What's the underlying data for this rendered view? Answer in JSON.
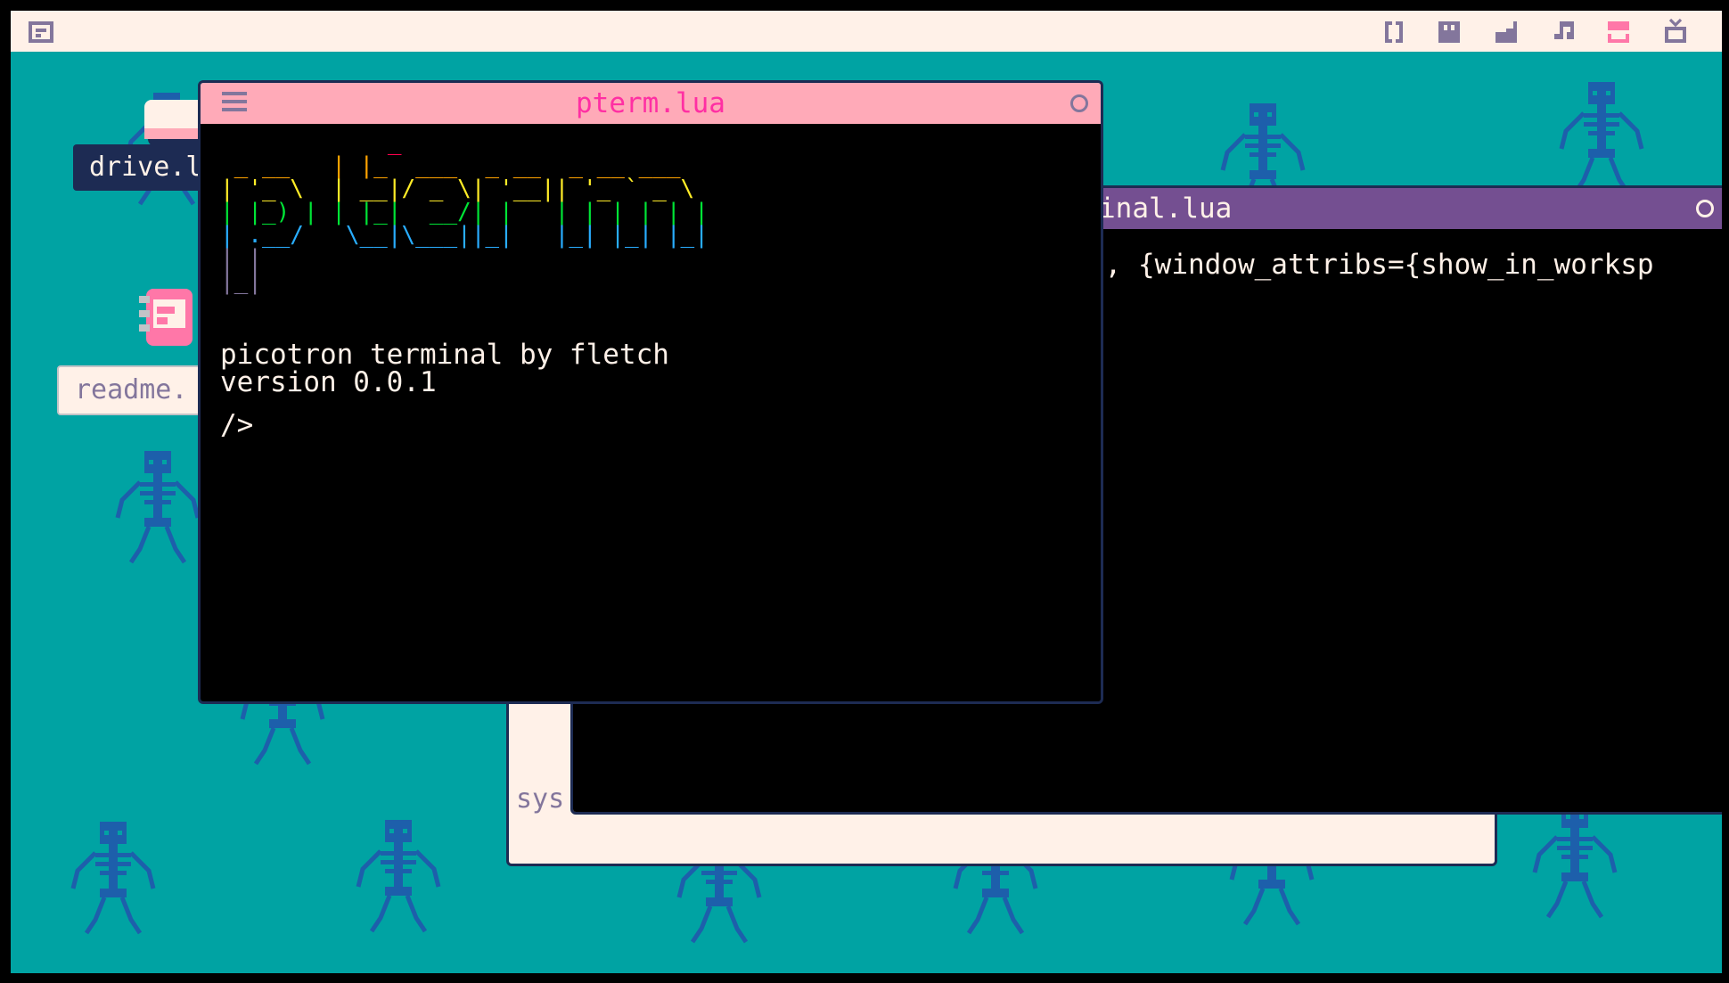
{
  "topbar": {
    "logo_icon": "picotron-logo-icon",
    "tools": [
      {
        "name": "code-editor-icon",
        "active": false
      },
      {
        "name": "sprite-editor-icon",
        "active": false
      },
      {
        "name": "map-editor-icon",
        "active": false
      },
      {
        "name": "music-editor-icon",
        "active": false
      },
      {
        "name": "workspace-icon",
        "active": true
      },
      {
        "name": "fullscreen-tv-icon",
        "active": false
      }
    ]
  },
  "desktop": {
    "icons": [
      {
        "name": "drive",
        "label": "drive.l",
        "icon": "drive-icon"
      },
      {
        "name": "readme",
        "label": "readme.",
        "icon": "readme-book-icon"
      }
    ]
  },
  "windows": {
    "system_window": {
      "label": "sys"
    },
    "terminal": {
      "title": "rminal.lua",
      "code_line": "\", {window_attribs={show_in_worksp"
    },
    "pterm": {
      "title": "pterm.lua",
      "menu_icon": "hamburger-menu-icon",
      "ascii_logo": [
        {
          "text": "            _",
          "color": "#ff004d"
        },
        {
          "text": " _ __   | |_  ___  _ __  _ __ ___",
          "color": "#ffa300"
        },
        {
          "text": "| '_ \\  | __|/ _ \\| '__|| '_ ` _ \\",
          "color": "#ffec27"
        },
        {
          "text": "| |_) | | |_|  __/| |   | | | | | |",
          "color": "#00e436"
        },
        {
          "text": "| .__/   \\__|\\___||_|   |_| |_| |_|",
          "color": "#29adff"
        },
        {
          "text": "| |",
          "color": "#83769c"
        },
        {
          "text": "|_|",
          "color": "#83769c"
        }
      ],
      "lines": [
        "picotron terminal by fletch",
        "version 0.0.1",
        "/>"
      ]
    }
  },
  "colors": {
    "desktop": "#00a3a3",
    "skeleton": "#1d5fab",
    "topbar": "#fff1e8",
    "pterm_titlebar": "#ffaab8",
    "pterm_title": "#ff2fa3",
    "terminal_titlebar": "#744f91",
    "text": "#fff1e8"
  }
}
